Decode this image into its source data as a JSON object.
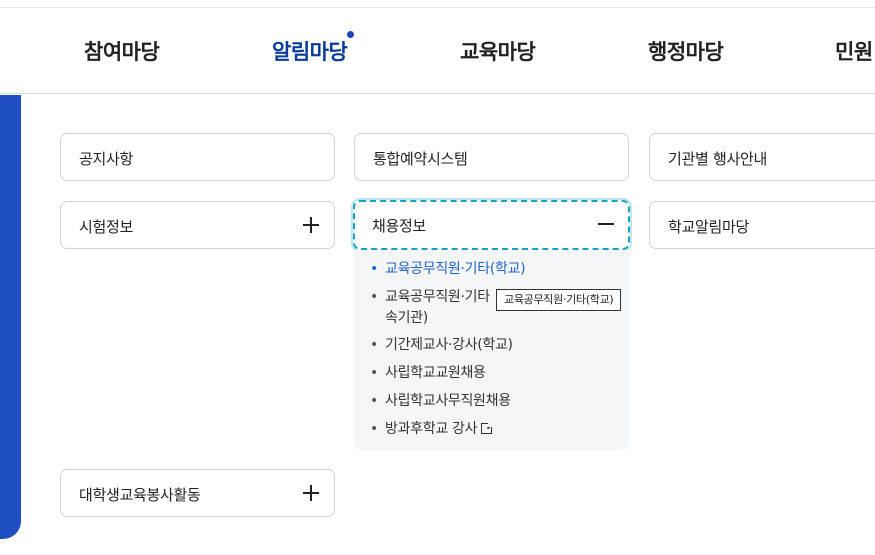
{
  "gnb": {
    "items": [
      {
        "label": "참여마당",
        "active": false
      },
      {
        "label": "알림마당",
        "active": true
      },
      {
        "label": "교육마당",
        "active": false
      },
      {
        "label": "행정마당",
        "active": false
      },
      {
        "label": "민원",
        "active": false
      }
    ]
  },
  "menu": {
    "col1": [
      {
        "label": "공지사항",
        "toggle": "none"
      },
      {
        "label": "시험정보",
        "toggle": "plus"
      },
      {
        "label": "대학생교육봉사활동",
        "toggle": "plus"
      }
    ],
    "col2": [
      {
        "label": "통합예약시스템",
        "toggle": "none"
      },
      {
        "label": "채용정보",
        "toggle": "minus",
        "expanded": true
      }
    ],
    "col3": [
      {
        "label": "기관별 행사안내",
        "toggle": "none"
      },
      {
        "label": "학교알림마당",
        "toggle": "none"
      }
    ]
  },
  "submenu": {
    "items": [
      {
        "text": "교육공무직원·기타(학교)",
        "active": true
      },
      {
        "text_line1": "교육공무직원·기타",
        "text_line2": "속기관)"
      },
      {
        "text": "기간제교사·강사(학교)"
      },
      {
        "text": "사립학교교원채용"
      },
      {
        "text": "사립학교사무직원채용"
      },
      {
        "text": "방과후학교 강사",
        "icon": "external-link-icon"
      }
    ],
    "bullet": "•"
  },
  "tooltip": {
    "text": "교육공무직원·기타(학교)"
  },
  "colors": {
    "accent": "#1f4ec2",
    "active_nav": "#0b3b99",
    "active_link": "#1f63c6",
    "focus": "#1aa3b8"
  }
}
